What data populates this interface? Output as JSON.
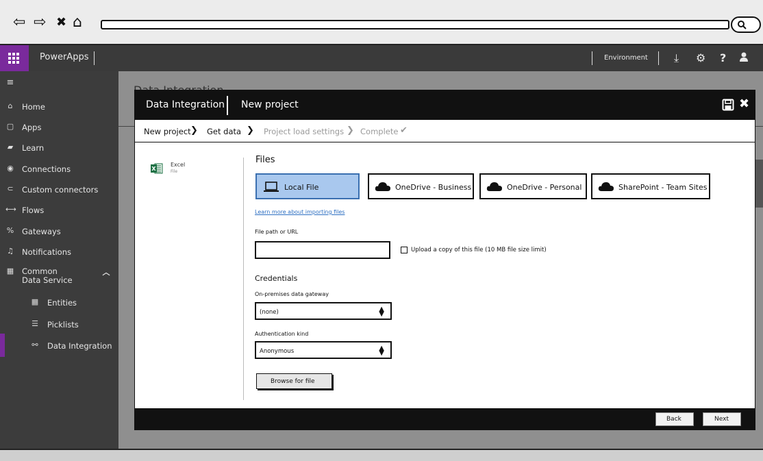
{
  "browser": {
    "back_icon": "back-arrow-icon",
    "forward_icon": "forward-arrow-icon",
    "stop_icon": "close-icon",
    "home_icon": "home-icon",
    "search_icon": "search-icon"
  },
  "app_bar": {
    "app_name": "PowerApps",
    "environment_label": "Environment",
    "icons": [
      "download-icon",
      "gear-icon",
      "help-icon",
      "user-icon"
    ],
    "accent_color": "#7a2a9c"
  },
  "sidebar": {
    "items": [
      {
        "label": "Home",
        "icon": "home-icon"
      },
      {
        "label": "Apps",
        "icon": "apps-icon"
      },
      {
        "label": "Learn",
        "icon": "book-icon"
      },
      {
        "label": "Connections",
        "icon": "connection-icon"
      },
      {
        "label": "Custom connectors",
        "icon": "connector-icon"
      },
      {
        "label": "Flows",
        "icon": "flow-icon"
      },
      {
        "label": "Gateways",
        "icon": "gateway-icon"
      },
      {
        "label": "Notifications",
        "icon": "bell-icon"
      },
      {
        "label": "Common Data Service",
        "icon": "table-icon",
        "expanded": true
      },
      {
        "label": "Entities",
        "icon": "grid-icon"
      },
      {
        "label": "Picklists",
        "icon": "list-icon"
      },
      {
        "label": "Data Integration",
        "icon": "integration-icon",
        "active": true
      }
    ]
  },
  "background_page": {
    "title": "Data Integration"
  },
  "modal": {
    "title": "Data Integration",
    "subtitle": "New project",
    "wizard": [
      {
        "label": "New project",
        "state": "done"
      },
      {
        "label": "Get data",
        "state": "current"
      },
      {
        "label": "Project load settings",
        "state": "todo"
      },
      {
        "label": "Complete",
        "state": "todo"
      }
    ],
    "source": {
      "name": "Excel",
      "kind": "File"
    },
    "files_heading": "Files",
    "sources": [
      {
        "label": "Local File",
        "selected": true
      },
      {
        "label": "OneDrive - Business",
        "selected": false
      },
      {
        "label": "OneDrive - Personal",
        "selected": false
      },
      {
        "label": "SharePoint - Team Sites",
        "selected": false
      }
    ],
    "learn_link": "Learn more about importing files",
    "file_path_label": "File path or URL",
    "file_path_value": "",
    "upload_copy_label": "Upload a copy of this file (10 MB file size limit)",
    "upload_copy_checked": false,
    "credentials_heading": "Credentials",
    "gateway_label": "On-premises data gateway",
    "gateway_value": "(none)",
    "auth_label": "Authentication kind",
    "auth_value": "Anonymous",
    "browse_button": "Browse for file",
    "back_button": "Back",
    "next_button": "Next",
    "selected_color": "#a9c8ee"
  }
}
